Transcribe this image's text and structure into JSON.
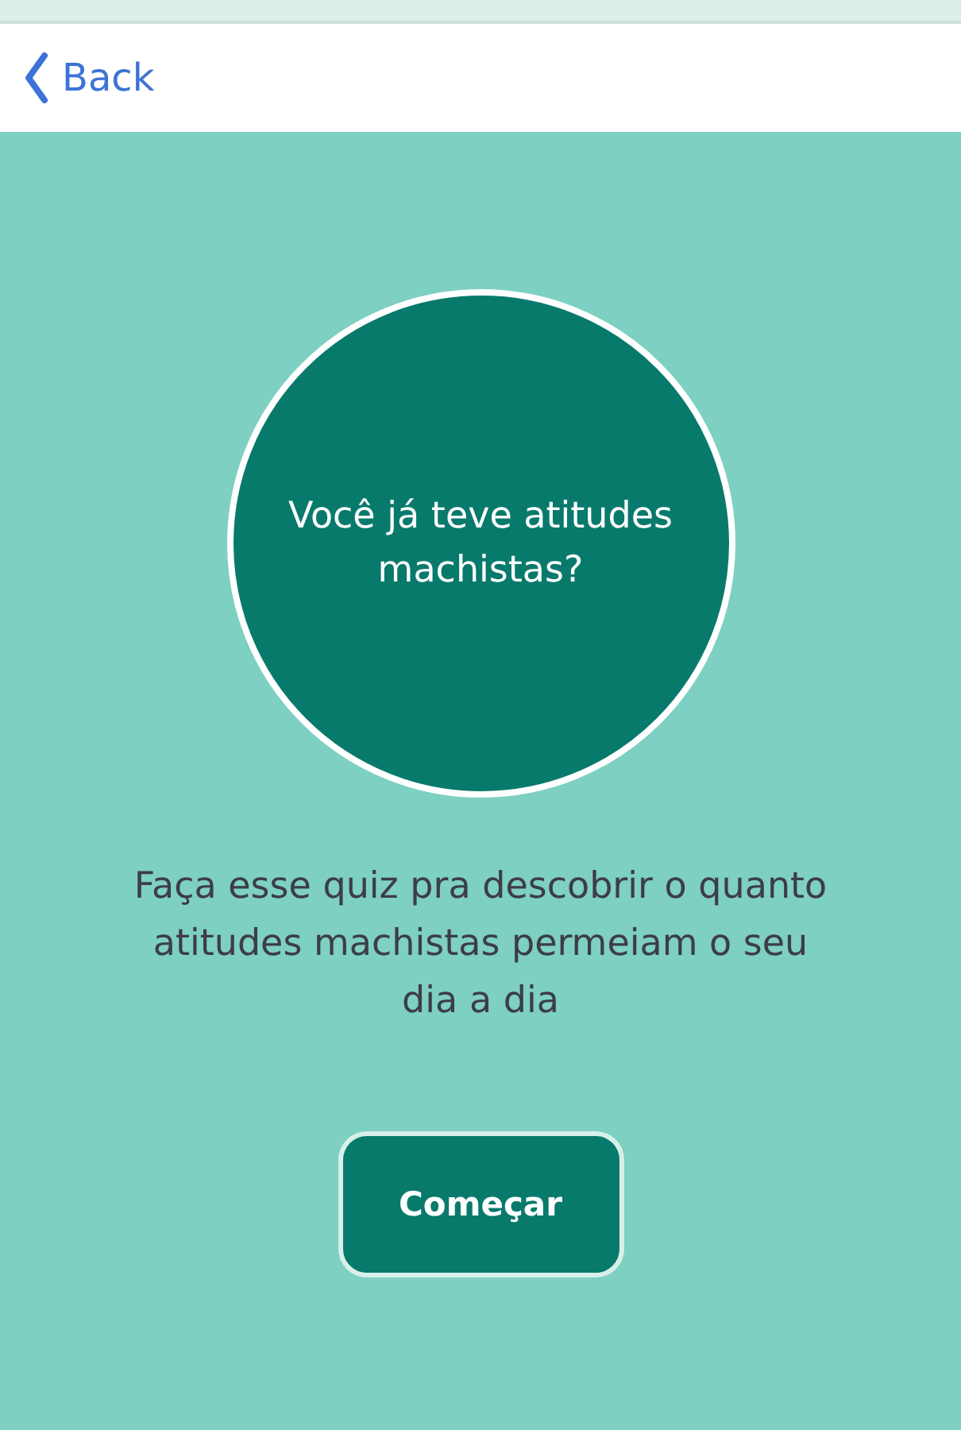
{
  "nav": {
    "back": "Back"
  },
  "quiz": {
    "title": "Você já teve atitudes machistas?",
    "description": "Faça esse quiz pra descobrir o quanto atitudes machistas permeiam o seu dia a dia",
    "start_button": "Começar"
  }
}
